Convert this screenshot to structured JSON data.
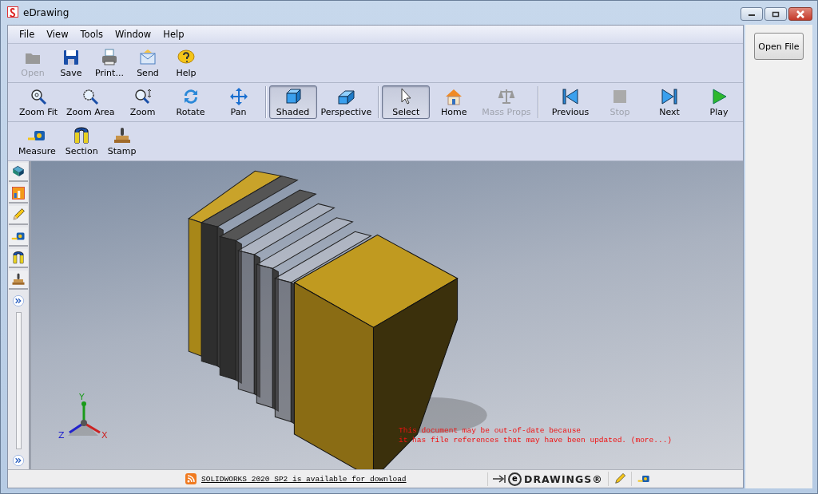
{
  "window": {
    "title": "eDrawing"
  },
  "menu": [
    "File",
    "View",
    "Tools",
    "Window",
    "Help"
  ],
  "toolbars": [
    {
      "groups": [
        {
          "buttons": [
            {
              "label": "Open",
              "disabled": true,
              "selected": false
            },
            {
              "label": "Save",
              "disabled": false,
              "selected": false
            },
            {
              "label": "Print...",
              "disabled": false,
              "selected": false
            },
            {
              "label": "Send",
              "disabled": false,
              "selected": false
            },
            {
              "label": "Help",
              "disabled": false,
              "selected": false
            }
          ]
        }
      ]
    },
    {
      "groups": [
        {
          "buttons": [
            {
              "label": "Zoom Fit",
              "disabled": false,
              "selected": false
            },
            {
              "label": "Zoom Area",
              "disabled": false,
              "selected": false
            },
            {
              "label": "Zoom",
              "disabled": false,
              "selected": false
            },
            {
              "label": "Rotate",
              "disabled": false,
              "selected": false
            },
            {
              "label": "Pan",
              "disabled": false,
              "selected": false
            }
          ]
        },
        {
          "buttons": [
            {
              "label": "Shaded",
              "disabled": false,
              "selected": true
            },
            {
              "label": "Perspective",
              "disabled": false,
              "selected": false
            }
          ]
        },
        {
          "buttons": [
            {
              "label": "Select",
              "disabled": false,
              "selected": true
            },
            {
              "label": "Home",
              "disabled": false,
              "selected": false
            },
            {
              "label": "Mass Props",
              "disabled": true,
              "selected": false
            }
          ]
        },
        {
          "buttons": [
            {
              "label": "Previous",
              "disabled": false,
              "selected": false
            },
            {
              "label": "Stop",
              "disabled": true,
              "selected": false
            },
            {
              "label": "Next",
              "disabled": false,
              "selected": false
            },
            {
              "label": "Play",
              "disabled": false,
              "selected": false
            }
          ]
        }
      ]
    },
    {
      "groups": [
        {
          "buttons": [
            {
              "label": "Measure",
              "disabled": false,
              "selected": false
            },
            {
              "label": "Section",
              "disabled": false,
              "selected": false
            },
            {
              "label": "Stamp",
              "disabled": false,
              "selected": false
            }
          ]
        }
      ]
    }
  ],
  "viewport": {
    "triad": {
      "x": "X",
      "y": "Y",
      "z": "Z"
    },
    "warning": [
      "This document may be out-of-date because",
      "it has file references that may have been updated. (more...)"
    ]
  },
  "status_bar": {
    "message": "SOLIDWORKS 2020 SP2 is available for download",
    "logo_mark": "e",
    "logo_text": "DRAWINGS®"
  },
  "side_panel": {
    "button": "Open File"
  }
}
